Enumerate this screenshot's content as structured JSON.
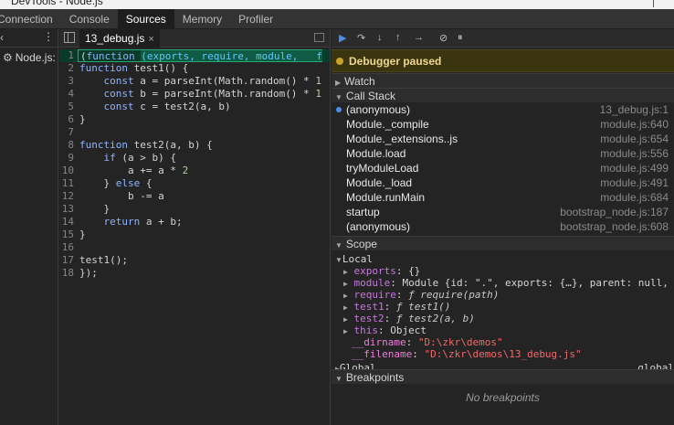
{
  "window": {
    "title": "DevTools - Node.js"
  },
  "main_tabs": [
    "Connection",
    "Console",
    "Sources",
    "Memory",
    "Profiler"
  ],
  "navigator": {
    "item_label": "Node.js: f"
  },
  "editor": {
    "tab_label": "13_debug.js",
    "close_glyph": "×",
    "lines": [
      "(function (exports, require, module, __f",
      "function test1() {",
      "    const a = parseInt(Math.random() * 1",
      "    const b = parseInt(Math.random() * 1",
      "    const c = test2(a, b)",
      "}",
      "",
      "function test2(a, b) {",
      "    if (a > b) {",
      "        a += a * 2",
      "    } else {",
      "        b -= a",
      "    }",
      "    return a + b;",
      "}",
      "",
      "test1();",
      "});"
    ]
  },
  "debugger": {
    "paused_text": "Debugger paused",
    "watch_label": "Watch",
    "callstack_label": "Call Stack",
    "call_stack": [
      {
        "fn": "(anonymous)",
        "loc": "13_debug.js:1"
      },
      {
        "fn": "Module._compile",
        "loc": "module.js:640"
      },
      {
        "fn": "Module._extensions..js",
        "loc": "module.js:654"
      },
      {
        "fn": "Module.load",
        "loc": "module.js:556"
      },
      {
        "fn": "tryModuleLoad",
        "loc": "module.js:499"
      },
      {
        "fn": "Module._load",
        "loc": "module.js:491"
      },
      {
        "fn": "Module.runMain",
        "loc": "module.js:684"
      },
      {
        "fn": "startup",
        "loc": "bootstrap_node.js:187"
      },
      {
        "fn": "(anonymous)",
        "loc": "bootstrap_node.js:608"
      }
    ],
    "scope_label": "Scope",
    "local_label": "Local",
    "scope_vars": [
      {
        "name": "exports",
        "value": "{}"
      },
      {
        "name": "module",
        "value": "Module {id: \".\", exports: {…}, parent: null, …"
      },
      {
        "name": "require",
        "value": "ƒ require(path)"
      },
      {
        "name": "test1",
        "value": "ƒ test1()"
      },
      {
        "name": "test2",
        "value": "ƒ test2(a, b)"
      },
      {
        "name": "this",
        "value": "Object"
      },
      {
        "name": "__dirname",
        "value": "\"D:\\zkr\\demos\""
      },
      {
        "name": "__filename",
        "value": "\"D:\\zkr\\demos\\13_debug.js\""
      }
    ],
    "global_label": "Global",
    "global_value": "global",
    "breakpoints_label": "Breakpoints",
    "no_breakpoints": "No breakpoints"
  }
}
